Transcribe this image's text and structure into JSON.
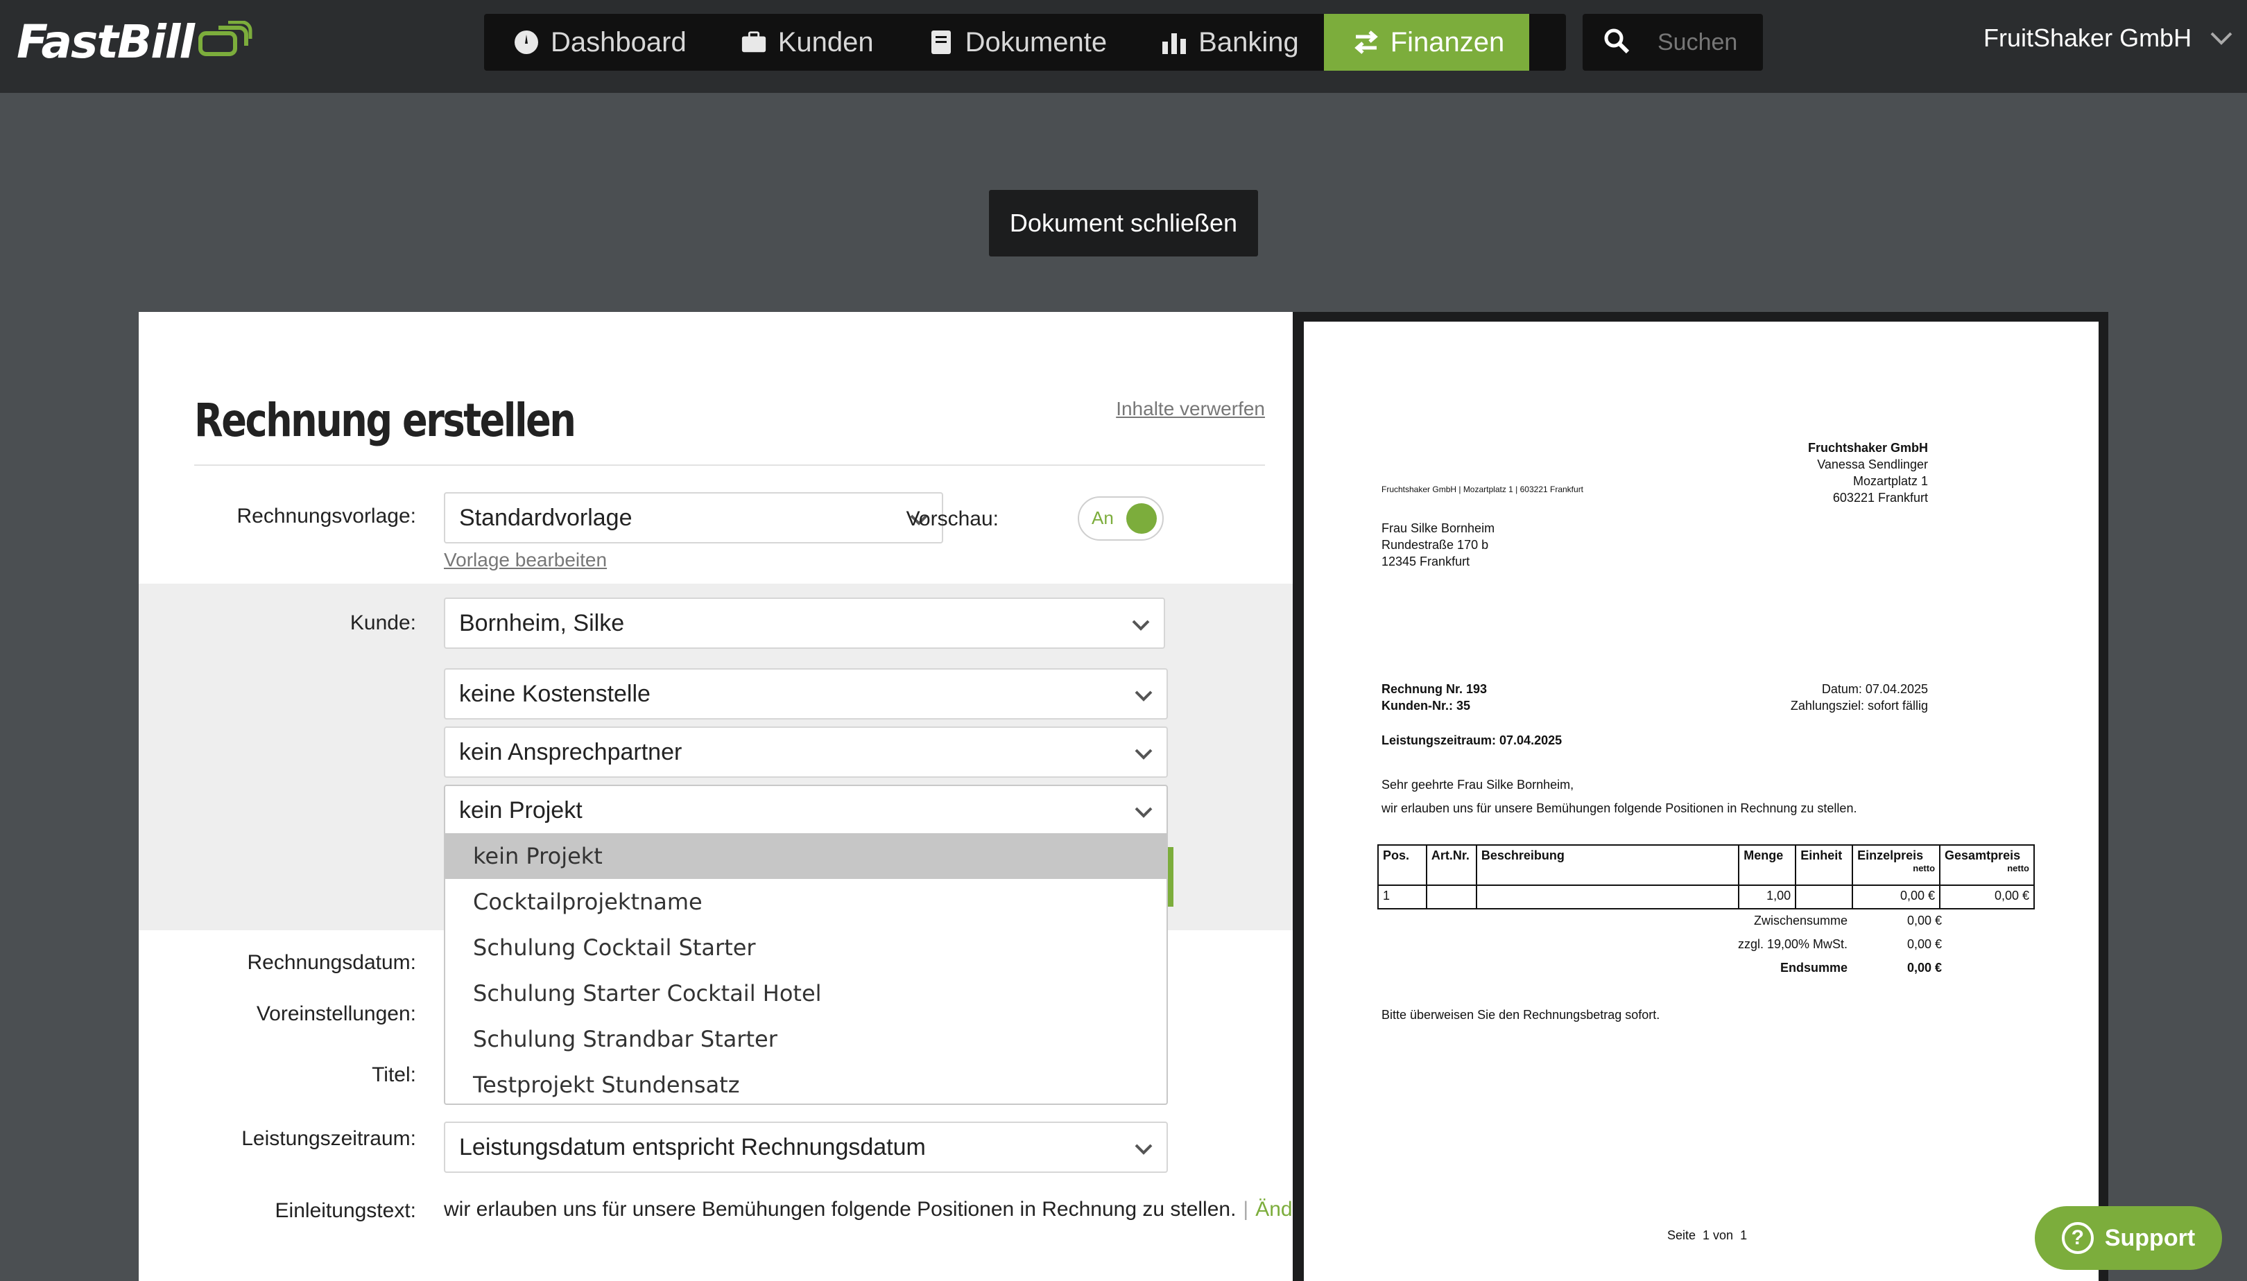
{
  "brand": {
    "name": "FastBill"
  },
  "nav": {
    "items": [
      {
        "label": "Dashboard",
        "icon": "dashboard-gauge-icon"
      },
      {
        "label": "Kunden",
        "icon": "briefcase-icon"
      },
      {
        "label": "Dokumente",
        "icon": "document-icon"
      },
      {
        "label": "Banking",
        "icon": "bar-chart-icon"
      },
      {
        "label": "Finanzen",
        "icon": "transfer-arrows-icon",
        "active": true
      }
    ],
    "search_placeholder": "Suchen",
    "account": "FruitShaker GmbH"
  },
  "close_button": "Dokument schließen",
  "form": {
    "title": "Rechnung erstellen",
    "discard_link": "Inhalte verwerfen",
    "template_label": "Rechnungsvorlage:",
    "template_value": "Standardvorlage",
    "edit_template_link": "Vorlage bearbeiten",
    "preview_label": "Vorschau:",
    "preview_toggle": "An",
    "customer_label": "Kunde:",
    "customer_value": "Bornheim, Silke",
    "cost_center_value": "keine Kostenstelle",
    "contact_value": "kein Ansprechpartner",
    "project_value": "kein Projekt",
    "project_options": [
      "kein Projekt",
      "Cocktailprojektname",
      "Schulung Cocktail Starter",
      "Schulung Starter Cocktail Hotel",
      "Schulung Strandbar Starter",
      "Testprojekt Stundensatz"
    ],
    "invoice_date_label": "Rechnungsdatum:",
    "presets_label": "Voreinstellungen:",
    "title_label": "Titel:",
    "service_period_label": "Leistungszeitraum:",
    "service_period_value": "Leistungsdatum entspricht Rechnungsdatum",
    "intro_label": "Einleitungstext:",
    "intro_text": "wir erlauben uns für unsere Bemühungen folgende Positionen in Rechnung zu stellen.",
    "intro_change": "Ändern"
  },
  "preview": {
    "sender_name": "Fruchtshaker GmbH",
    "sender_contact": "Vanessa Sendlinger",
    "sender_street": "Mozartplatz 1",
    "sender_city": "603221 Frankfurt",
    "sender_line": "Fruchtshaker GmbH | Mozartplatz 1 | 603221 Frankfurt",
    "recipient_name": "Frau Silke Bornheim",
    "recipient_street": "Rundestraße 170 b",
    "recipient_city": "12345 Frankfurt",
    "invoice_no": "Rechnung Nr. 193",
    "customer_no": "Kunden-Nr.: 35",
    "date": "Datum: 07.04.2025",
    "payment_terms": "Zahlungsziel: sofort fällig",
    "service_period": "Leistungszeitraum: 07.04.2025",
    "salutation": "Sehr geehrte Frau Silke Bornheim,",
    "intro": "wir erlauben uns für unsere Bemühungen folgende Positionen in Rechnung zu stellen.",
    "table": {
      "headers": [
        "Pos.",
        "Art.Nr.",
        "Beschreibung",
        "Menge",
        "Einheit",
        "Einzelpreis",
        "Gesamtpreis"
      ],
      "netto": "netto",
      "row": [
        "1",
        "",
        "",
        "1,00",
        "",
        "0,00 €",
        "0,00 €"
      ]
    },
    "subtotal_label": "Zwischensumme",
    "subtotal_value": "0,00 €",
    "tax_label": "zzgl. 19,00% MwSt.",
    "tax_value": "0,00 €",
    "total_label": "Endsumme",
    "total_value": "0,00 €",
    "closing": "Bitte überweisen Sie den Rechnungsbetrag sofort.",
    "page_info": "Seite  1 von  1"
  },
  "support": {
    "label": "Support"
  }
}
